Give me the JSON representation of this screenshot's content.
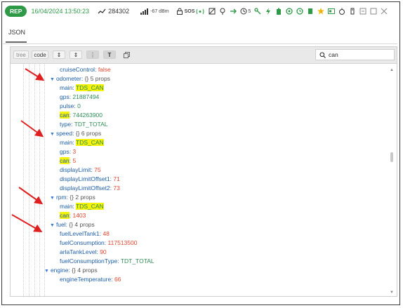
{
  "status_bar": {
    "badge": "REP",
    "timestamp": "16/04/2024 13:50:23",
    "trend_value": "284302",
    "signal_value": "-67 dBm",
    "sos_label": "SOS",
    "extra_count": "5",
    "accent_color": "#2e9a47"
  },
  "tabs": {
    "active": "JSON"
  },
  "toolbar": {
    "tree_label": "tree",
    "code_label": "code",
    "search_value": "can"
  },
  "json_lines": [
    {
      "key": "cruiseControl:",
      "value": "false",
      "type": "bool"
    },
    {
      "key": "odometer:",
      "meta": "{} 5 props",
      "type": "object"
    },
    {
      "key": "main:",
      "value": "TDS_CAN",
      "type": "hl-str"
    },
    {
      "key": "gps:",
      "value": "21887494",
      "type": "str"
    },
    {
      "key": "pulse:",
      "value": "0",
      "type": "str"
    },
    {
      "key": "can:",
      "value": "744263900",
      "type": "str"
    },
    {
      "key": "type:",
      "value": "TDT_TOTAL",
      "type": "str"
    },
    {
      "key": "speed:",
      "meta": "{} 6 props",
      "type": "object"
    },
    {
      "key": "main:",
      "value": "TDS_CAN",
      "type": "hl-str"
    },
    {
      "key": "gps:",
      "value": "3",
      "type": "num"
    },
    {
      "key": "can:",
      "value": "5",
      "type": "num"
    },
    {
      "key": "displayLimit:",
      "value": "75",
      "type": "num"
    },
    {
      "key": "displayLimitOffset1:",
      "value": "71",
      "type": "num"
    },
    {
      "key": "displayLimitOffset2:",
      "value": "73",
      "type": "num"
    },
    {
      "key": "rpm:",
      "meta": "{} 2 props",
      "type": "object"
    },
    {
      "key": "main:",
      "value": "TDS_CAN",
      "type": "hl-str"
    },
    {
      "key": "can:",
      "value": "1403",
      "type": "num"
    },
    {
      "key": "fuel:",
      "meta": "{} 4 props",
      "type": "object"
    },
    {
      "key": "fuelLevelTank1:",
      "value": "48",
      "type": "num"
    },
    {
      "key": "fuelConsumption:",
      "value": "117513500",
      "type": "num"
    },
    {
      "key": "arlaTankLevel:",
      "value": "90",
      "type": "num"
    },
    {
      "key": "fuelConsumptionType:",
      "value": "TDT_TOTAL",
      "type": "str"
    },
    {
      "key": "engine:",
      "meta": "{} 4 props",
      "type": "object"
    },
    {
      "key": "engineTemperature:",
      "value": "66",
      "type": "num"
    }
  ]
}
